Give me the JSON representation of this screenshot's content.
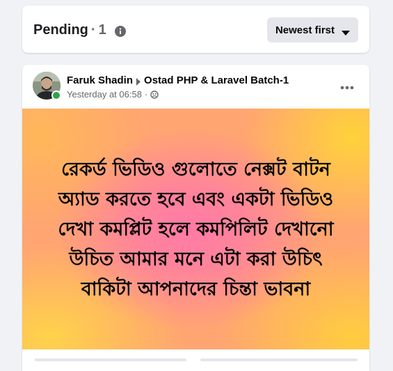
{
  "pending_header": {
    "label": "Pending",
    "separator": "·",
    "count": "1",
    "info_icon": "info-icon"
  },
  "sort": {
    "label": "Newest first",
    "icon": "caret-down-icon"
  },
  "post": {
    "author": "Faruk Shadin",
    "group": "Ostad PHP & Laravel Batch-1",
    "timestamp": "Yesterday at 06:58",
    "meta_separator": "·",
    "privacy_icon": "members-icon",
    "more_icon": "more-options-icon",
    "online_status_color": "#31a24c",
    "text": "রেকর্ড ভিডিও গুলোতে নেক্সট বাটন অ্যাড করতে হবে এবং একটা ভিডিও দেখা কমপ্লিট হলে কমপিলিট দেখানো উচিত আমার মনে এটা করা উচিৎ বাকিটা আপনাদের চিন্তা ভাবনা"
  },
  "colors": {
    "page_bg": "#f0f2f5",
    "button_bg": "#e4e6eb",
    "secondary_text": "#65676b"
  }
}
